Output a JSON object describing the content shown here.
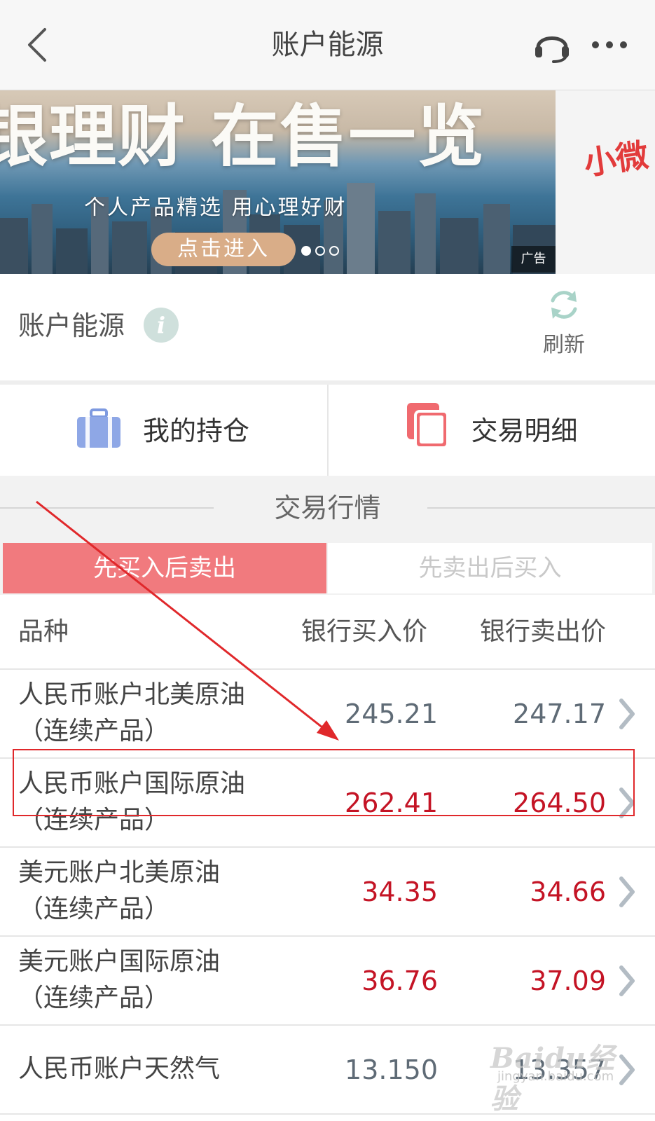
{
  "header": {
    "title": "账户能源",
    "back_icon": "chevron-left-icon",
    "service_icon": "headset-icon",
    "more_icon": "more-dots-icon"
  },
  "banner": {
    "headline": "银理财 在售一览",
    "subtitle": "个人产品精选  用心理好财",
    "cta": "点击进入",
    "ad_label": "广告",
    "next_slide_peek": "小微",
    "slide_count": 3,
    "active_slide": 1
  },
  "section": {
    "title": "账户能源",
    "info_icon": "i",
    "refresh_label": "刷新"
  },
  "quick_actions": [
    {
      "label": "我的持仓",
      "icon": "briefcase-icon",
      "color": "#7e9ae0"
    },
    {
      "label": "交易明细",
      "icon": "documents-icon",
      "color": "#f06a6f"
    }
  ],
  "market": {
    "title": "交易行情",
    "tabs": [
      {
        "label": "先买入后卖出",
        "active": true
      },
      {
        "label": "先卖出后买入",
        "active": false
      }
    ],
    "columns": [
      "品种",
      "银行买入价",
      "银行卖出价"
    ],
    "rows": [
      {
        "name_l1": "人民币账户北美原油",
        "name_l2": "（连续产品）",
        "buy": "245.21",
        "sell": "247.17",
        "color": "#5f6b76"
      },
      {
        "name_l1": "人民币账户国际原油",
        "name_l2": "（连续产品）",
        "buy": "262.41",
        "sell": "264.50",
        "color": "#c41425"
      },
      {
        "name_l1": "美元账户北美原油",
        "name_l2": "（连续产品）",
        "buy": "34.35",
        "sell": "34.66",
        "color": "#c41425"
      },
      {
        "name_l1": "美元账户国际原油",
        "name_l2": "（连续产品）",
        "buy": "36.76",
        "sell": "37.09",
        "color": "#c41425"
      },
      {
        "name_l1": "人民币账户天然气",
        "name_l2": "",
        "buy": "13.150",
        "sell": "13.357",
        "color": "#5f6b76"
      }
    ]
  },
  "watermark": {
    "brand": "Baidu经验",
    "url": "jingyan.baidu.com"
  },
  "colors": {
    "accent": "#f17a7e",
    "price_up": "#c41425",
    "price_flat": "#5f6b76",
    "annotation": "#e0282b"
  }
}
